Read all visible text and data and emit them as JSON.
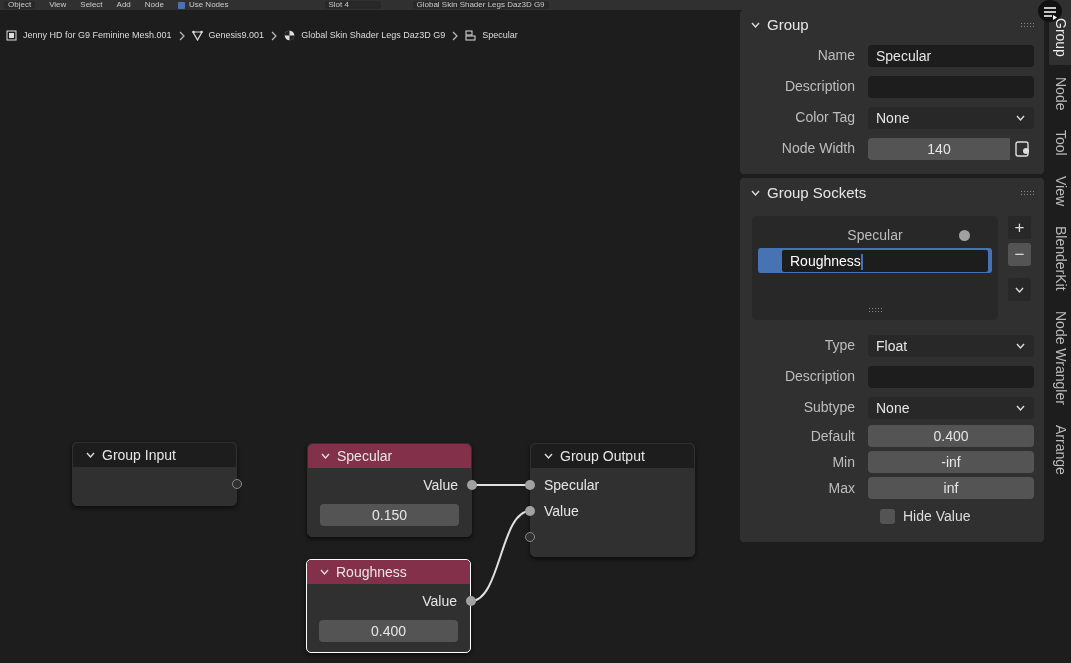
{
  "header": {
    "mode": "Object",
    "menus": [
      "View",
      "Select",
      "Add",
      "Node"
    ],
    "use_nodes": {
      "label": "Use Nodes",
      "checked": true
    },
    "slot": "Slot 4",
    "material": "Global Skin Shader Legs Daz3D G9"
  },
  "breadcrumbs": [
    {
      "kind": "object",
      "label": "Jenny HD for G9 Feminine Mesh.001"
    },
    {
      "kind": "mesh",
      "label": "Genesis9.001"
    },
    {
      "kind": "material",
      "label": "Global Skin Shader Legs Daz3D G9"
    },
    {
      "kind": "group",
      "label": "Specular"
    }
  ],
  "nodes": [
    {
      "kind": "group",
      "title": "Group Input",
      "selected": false,
      "rows": [
        {
          "kind": "output",
          "label": "",
          "connected": false
        }
      ]
    },
    {
      "kind": "value",
      "title": "Specular",
      "selected": false,
      "rows": [
        {
          "kind": "output",
          "label": "Value",
          "connected": true
        },
        {
          "kind": "field",
          "value": "0.150"
        }
      ]
    },
    {
      "kind": "value",
      "title": "Roughness",
      "selected": true,
      "rows": [
        {
          "kind": "output",
          "label": "Value",
          "connected": true
        },
        {
          "kind": "field",
          "value": "0.400"
        }
      ]
    },
    {
      "kind": "group",
      "title": "Group Output",
      "selected": false,
      "rows": [
        {
          "kind": "input",
          "label": "Specular",
          "connected": true
        },
        {
          "kind": "input",
          "label": "Value",
          "connected": true
        },
        {
          "kind": "input",
          "label": "",
          "connected": false
        }
      ]
    }
  ],
  "group_panel": {
    "title": "Group",
    "props": [
      {
        "kind": "text",
        "label": "Name",
        "value": "Specular"
      },
      {
        "kind": "text",
        "label": "Description"
      },
      {
        "kind": "select",
        "label": "Color Tag",
        "value": "None"
      },
      {
        "kind": "number",
        "label": "Node Width",
        "value": "140"
      }
    ]
  },
  "sockets_panel": {
    "title": "Group Sockets",
    "items": [
      {
        "label": "Specular",
        "selected": false
      },
      {
        "label": "Roughness",
        "selected": true
      }
    ],
    "buttons": [
      "+",
      "−"
    ],
    "props": [
      {
        "kind": "select",
        "label": "Type",
        "value": "Float"
      },
      {
        "kind": "text",
        "label": "Description"
      },
      {
        "kind": "select",
        "label": "Subtype",
        "value": "None"
      },
      {
        "kind": "number",
        "label": "Default",
        "value": "0.400"
      },
      {
        "kind": "number",
        "label": "Min",
        "value": "-inf"
      },
      {
        "kind": "number",
        "label": "Max",
        "value": "inf"
      }
    ],
    "hide_value": {
      "label": "Hide Value",
      "checked": false
    }
  },
  "tabs": [
    {
      "label": "Group",
      "selected": true
    },
    {
      "label": "Node",
      "selected": false
    },
    {
      "label": "Tool",
      "selected": false
    },
    {
      "label": "View",
      "selected": false
    },
    {
      "label": "BlenderKit",
      "selected": false
    },
    {
      "label": "Node Wrangler",
      "selected": false
    },
    {
      "label": "Arrange",
      "selected": false
    }
  ]
}
